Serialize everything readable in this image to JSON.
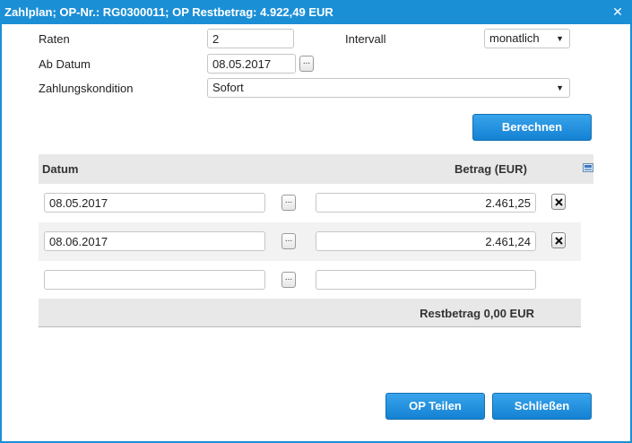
{
  "window": {
    "title": "Zahlplan; OP-Nr.: RG0300011; OP Restbetrag: 4.922,49 EUR"
  },
  "form": {
    "raten_label": "Raten",
    "raten_value": "2",
    "intervall_label": "Intervall",
    "intervall_value": "monatlich",
    "ab_datum_label": "Ab Datum",
    "ab_datum_value": "08.05.2017",
    "zahlungskondition_label": "Zahlungskondition",
    "zahlungskondition_value": "Sofort",
    "date_picker_label": "...",
    "berechnen_label": "Berechnen"
  },
  "table": {
    "col_datum": "Datum",
    "col_betrag": "Betrag (EUR)",
    "rows": [
      {
        "datum": "08.05.2017",
        "betrag": "2.461,25"
      },
      {
        "datum": "08.06.2017",
        "betrag": "2.461,24"
      },
      {
        "datum": "",
        "betrag": ""
      }
    ],
    "restbetrag": "Restbetrag 0,00 EUR"
  },
  "footer": {
    "op_teilen_label": "OP Teilen",
    "schliessen_label": "Schließen"
  },
  "colors": {
    "accent": "#1b8fd6"
  }
}
